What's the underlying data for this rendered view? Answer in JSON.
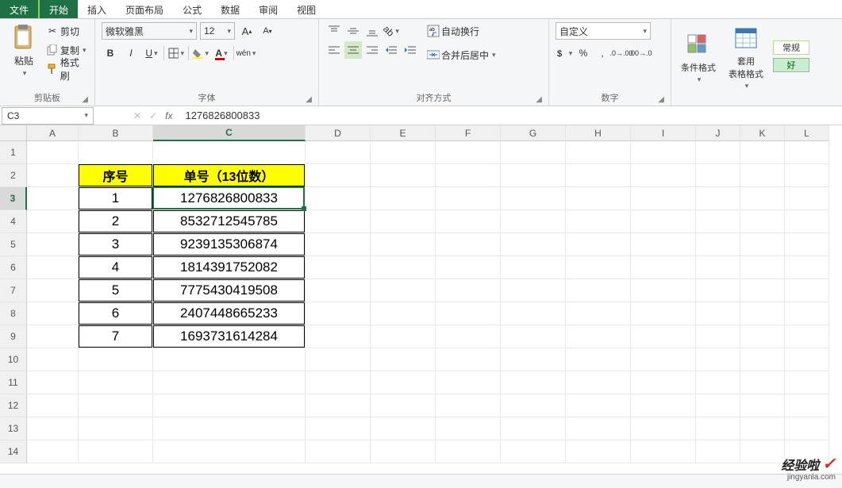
{
  "menubar": {
    "file": "文件",
    "start": "开始",
    "insert": "插入",
    "layout": "页面布局",
    "formula": "公式",
    "data": "数据",
    "review": "审阅",
    "view": "视图"
  },
  "ribbon": {
    "clipboard": {
      "cut": "剪切",
      "copy": "复制",
      "paste": "粘贴",
      "painter": "格式刷",
      "group": "剪贴板"
    },
    "font": {
      "name": "微软雅黑",
      "size": "12",
      "group": "字体",
      "bold": "B",
      "italic": "I",
      "underline": "U",
      "wen": "wén"
    },
    "align": {
      "wrap": "自动换行",
      "merge": "合并后居中",
      "group": "对齐方式"
    },
    "number": {
      "format": "自定义",
      "group": "数字",
      "percent": "%",
      "comma": ","
    },
    "styles": {
      "cond": "条件格式",
      "table": "套用\n表格格式",
      "normal": "常规",
      "good": "好"
    }
  },
  "namebox": {
    "ref": "C3"
  },
  "formula": {
    "value": "1276826800833"
  },
  "columns": [
    "A",
    "B",
    "C",
    "D",
    "E",
    "F",
    "G",
    "H",
    "I",
    "J",
    "K",
    "L"
  ],
  "rows": [
    "1",
    "2",
    "3",
    "4",
    "5",
    "6",
    "7",
    "8",
    "9",
    "10",
    "11",
    "12",
    "13",
    "14"
  ],
  "table": {
    "headers": {
      "b": "序号",
      "c": "单号（13位数）"
    },
    "data": [
      {
        "b": "1",
        "c": "1276826800833"
      },
      {
        "b": "2",
        "c": "8532712545785"
      },
      {
        "b": "3",
        "c": "9239135306874"
      },
      {
        "b": "4",
        "c": "1814391752082"
      },
      {
        "b": "5",
        "c": "7775430419508"
      },
      {
        "b": "6",
        "c": "2407448665233"
      },
      {
        "b": "7",
        "c": "1693731614284"
      }
    ]
  },
  "selection": {
    "active_row": 3,
    "active_col": "C"
  },
  "watermark": {
    "brand": "经验啦",
    "url": "jingyanla.com"
  }
}
